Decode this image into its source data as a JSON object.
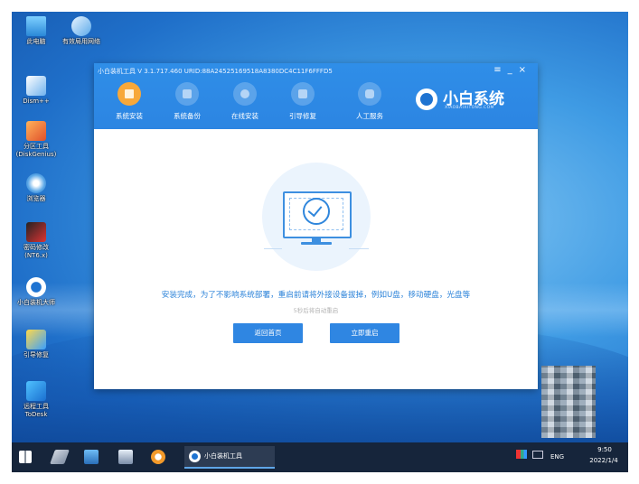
{
  "desktop": {
    "icons": [
      {
        "label": "此电脑"
      },
      {
        "label": "有效局用网络"
      },
      {
        "label": "Dism++"
      },
      {
        "label": "分区工具"
      },
      {
        "label": "(DiskGenius)"
      },
      {
        "label": "浏览器"
      },
      {
        "label": "密码修改"
      },
      {
        "label": "(NT6.x)"
      },
      {
        "label": "小白装机大师"
      },
      {
        "label": "引导修复"
      },
      {
        "label": "远程工具"
      },
      {
        "label": "ToDesk"
      }
    ]
  },
  "window": {
    "title": "小白装机工具 V 3.1.717.460 URID:88A24525169518A8380DC4C11F6FFFD5",
    "controls": {
      "menu": "≡",
      "minimize": "_",
      "close": "×"
    },
    "nav": [
      {
        "label": "系统安装"
      },
      {
        "label": "系统备份"
      },
      {
        "label": "在线安装"
      },
      {
        "label": "引导修复"
      },
      {
        "label": "人工服务"
      }
    ],
    "brand": {
      "name": "小白系统",
      "subtitle": "XIAOBAIXITONG.COM"
    },
    "message": "安装完成，为了不影响系统部署，重启前请将外接设备拔掉，例如U盘，移动硬盘，光盘等",
    "countdown": "5秒后将自动重启",
    "buttons": {
      "home": "返回首页",
      "restart": "立即重启"
    }
  },
  "taskbar": {
    "app_label": "小白装机工具",
    "lang": "ENG",
    "time": "9:50",
    "date": "2022/1/4"
  },
  "colors": {
    "accent": "#2f86e2",
    "active_nav": "#f7a83a",
    "taskbar": "#16253b"
  }
}
